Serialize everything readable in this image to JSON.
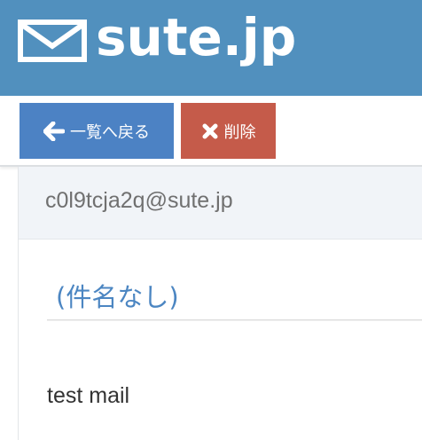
{
  "header": {
    "logo_icon": "envelope-icon",
    "logo_text": "sute.jp",
    "background_color": "#5190be"
  },
  "toolbar": {
    "back_button": {
      "label": "一覧へ戻る",
      "icon": "arrow-left-icon",
      "color": "#4c82c4"
    },
    "delete_button": {
      "label": "削除",
      "icon": "close-icon",
      "color": "#c55b4a"
    }
  },
  "mail": {
    "address": "c0l9tcja2q@sute.jp",
    "subject": "(件名なし)",
    "body": "test mail"
  }
}
